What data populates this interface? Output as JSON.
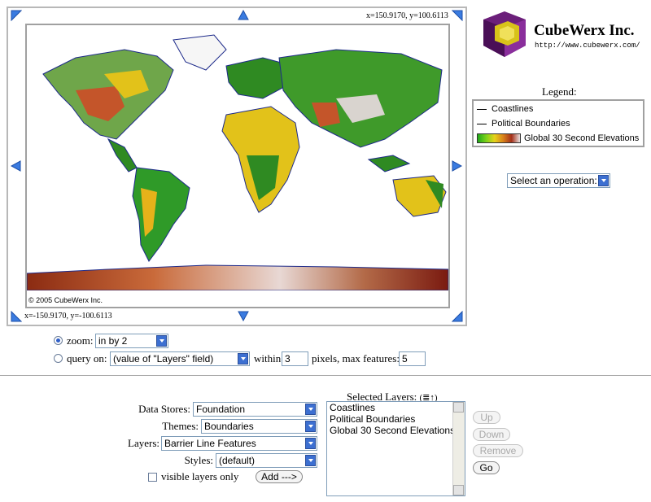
{
  "map": {
    "coord_top_right": "x=150.9170, y=100.6113",
    "coord_bottom_left": "x=-150.9170, y=-100.6113",
    "copyright": "© 2005 CubeWerx Inc."
  },
  "logo": {
    "title": "CubeWerx Inc.",
    "url": "http://www.cubewerx.com/"
  },
  "legend": {
    "heading": "Legend:",
    "items": [
      {
        "label": "Coastlines"
      },
      {
        "label": "Political Boundaries"
      },
      {
        "label": "Global 30 Second Elevations"
      }
    ]
  },
  "operation_select": {
    "value": "Select an operation:"
  },
  "zoom": {
    "label": "zoom:",
    "value": "in by 2",
    "selected": true
  },
  "query": {
    "label": "query on:",
    "field_value": "(value of \"Layers\" field)",
    "within_label": "within",
    "within_value": "3",
    "pixels_label": "pixels, max features:",
    "max_features_value": "5"
  },
  "form": {
    "data_stores_label": "Data Stores:",
    "data_stores_value": "Foundation",
    "themes_label": "Themes:",
    "themes_value": "Boundaries",
    "layers_label": "Layers:",
    "layers_value": "Barrier Line Features",
    "styles_label": "Styles:",
    "styles_value": "(default)",
    "visible_only_label": "visible layers only",
    "add_button": "Add --->"
  },
  "selected_layers": {
    "heading": "Selected Layers:",
    "items": [
      "Coastlines",
      "Political Boundaries",
      "Global 30 Second Elevations"
    ]
  },
  "buttons": {
    "up": "Up",
    "down": "Down",
    "remove": "Remove",
    "go": "Go"
  }
}
